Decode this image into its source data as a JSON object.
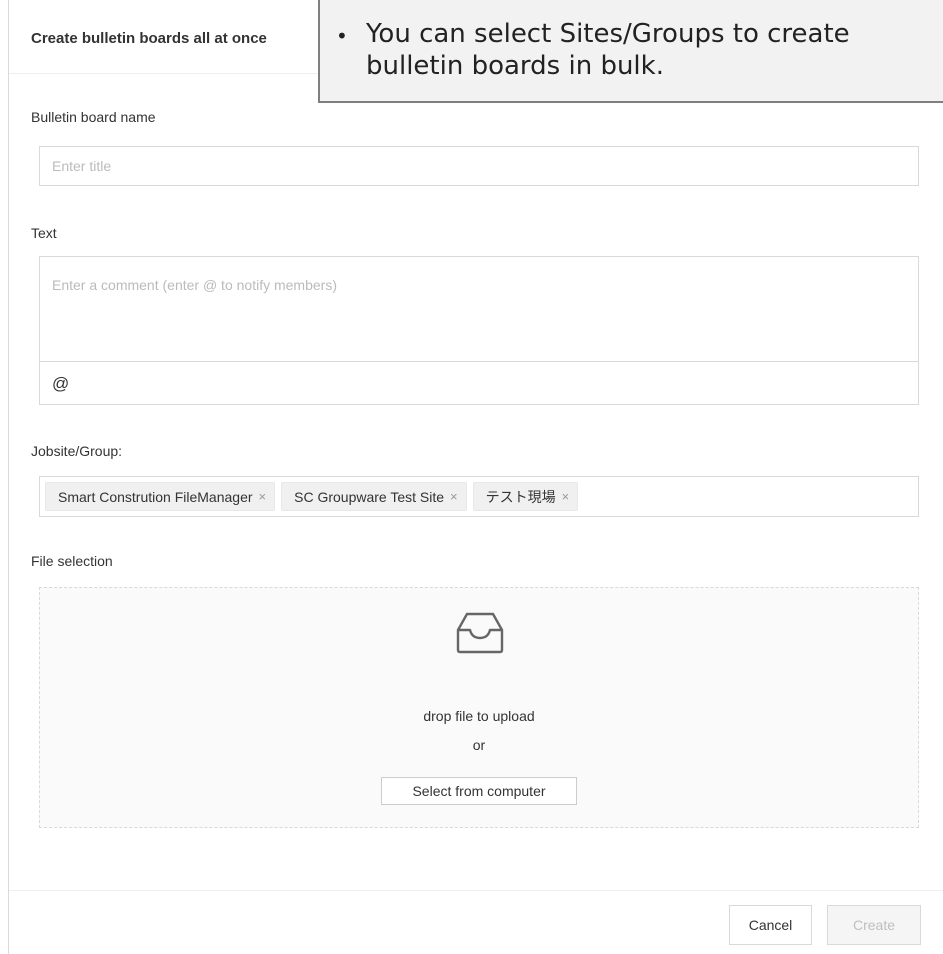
{
  "modal": {
    "title": "Create bulletin boards all at once",
    "fields": {
      "name_label": "Bulletin board name",
      "name_placeholder": "Enter title",
      "text_label": "Text",
      "text_placeholder": "Enter a comment (enter @ to notify members)",
      "mention_symbol": "@",
      "jobsite_label": "Jobsite/Group:",
      "tags": [
        {
          "label": "Smart Constrution FileManager",
          "remove": "×"
        },
        {
          "label": "SC Groupware Test Site",
          "remove": "×"
        },
        {
          "label": "テスト現場",
          "remove": "×"
        }
      ],
      "file_label": "File selection"
    },
    "dropzone": {
      "drop_text": "drop file to upload",
      "or_text": "or",
      "select_button": "Select from computer",
      "icon": "inbox-icon"
    },
    "footer": {
      "cancel": "Cancel",
      "create": "Create"
    }
  },
  "callout": {
    "bullet": "•",
    "text": "You can select Sites/Groups to create bulletin boards in bulk."
  },
  "colors": {
    "border": "#d9d9d9",
    "tag_bg": "#f0f0f0",
    "callout_bg": "#f2f2f2",
    "disabled_text": "#bfbfbf"
  }
}
